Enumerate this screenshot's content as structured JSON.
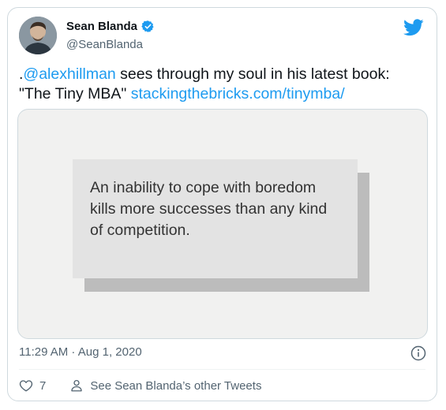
{
  "tweet": {
    "author": {
      "name": "Sean Blanda",
      "handle": "@SeanBlanda",
      "verified": true
    },
    "text": {
      "prefix": ".",
      "mention": "@alexhillman",
      "body": " sees through my soul in his latest book: \"The Tiny MBA\" ",
      "link": "stackingthebricks.com/tinymba/"
    },
    "media": {
      "quote": "An inability to cope with boredom kills more successes than any kind of competition."
    },
    "timestamp": "11:29 AM · Aug 1, 2020",
    "likes": "7",
    "other_tweets_label": "See Sean Blanda’s other Tweets"
  },
  "icons": {
    "brand": "twitter-bird-icon",
    "verified": "verified-badge-icon",
    "info": "info-icon",
    "like": "heart-icon",
    "profile": "person-icon"
  },
  "colors": {
    "accent": "#1d9bf0",
    "text": "#0f1419",
    "secondary": "#536471",
    "border": "#cfd9de"
  }
}
